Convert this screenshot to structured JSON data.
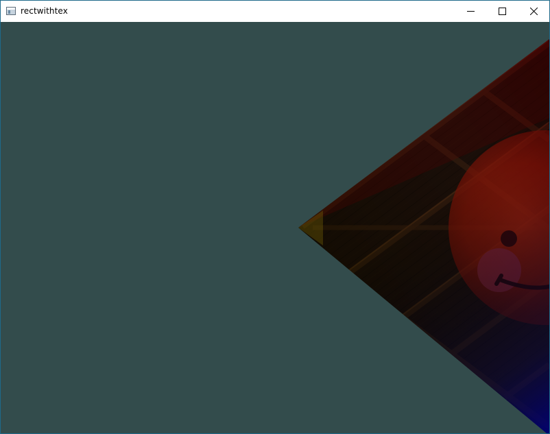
{
  "window": {
    "title": "rectwithtex",
    "icons": {
      "app": "app-window-icon",
      "minimize": "minimize-icon",
      "maximize": "maximize-icon",
      "close": "close-icon"
    }
  },
  "scene": {
    "clear_color": "#334c4c",
    "texture": "wooden-container-with-smiley-overlay",
    "corner_colors": [
      "#ff0000",
      "#00ff00",
      "#0000ff",
      "#ffff00"
    ]
  }
}
